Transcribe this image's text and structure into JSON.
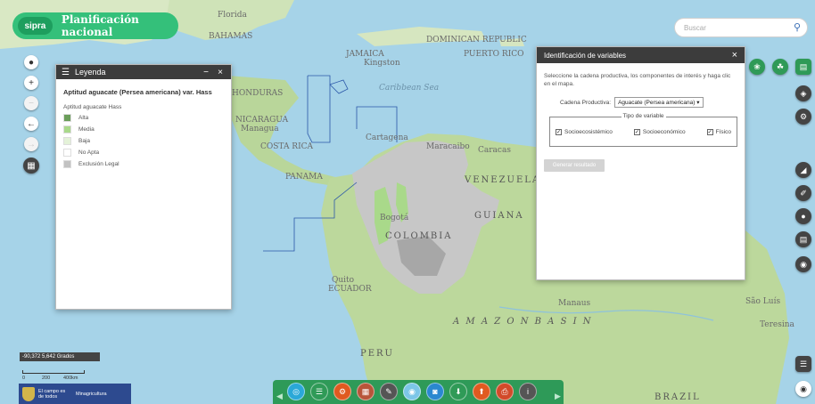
{
  "brand": {
    "logo": "sipra",
    "title": "Planificación nacional"
  },
  "search": {
    "placeholder": "Buscar",
    "icon": "search-icon"
  },
  "map": {
    "labels": {
      "florida": "Florida",
      "bahamas": "BAHAMAS",
      "jamaica": "JAMAICA",
      "kingston": "Kingston",
      "dominican": "DOMINICAN REPUBLIC",
      "puerto_rico": "PUERTO RICO",
      "honduras": "HONDURAS",
      "nicaragua": "NICARAGUA",
      "managua": "Managua",
      "costa_rica": "COSTA RICA",
      "panama": "PANAMA",
      "caribbean": "Caribbean Sea",
      "cartagena": "Cartagena",
      "maracaibo": "Maracaibo",
      "caracas": "Caracas",
      "venezuela": "VENEZUELA",
      "guiana": "GUIANA",
      "colombia": "COLOMBIA",
      "bogota": "Bogotá",
      "ecuador": "ECUADOR",
      "quito": "Quito",
      "amazon": "A M A Z O N     B A S I N",
      "manaus": "Manaus",
      "peru": "PERU",
      "brazil": "BRAZIL",
      "sao_luis": "São Luís",
      "teresina": "Teresina"
    }
  },
  "left_tools": {
    "locate": "locate-icon",
    "zoom_in": "+",
    "zoom_out": "−",
    "back": "←",
    "forward": "→",
    "grid": "grid-icon"
  },
  "legend": {
    "title": "Leyenda",
    "minimize": "−",
    "close": "×",
    "layer_title": "Aptitud aguacate (Persea americana) var. Hass",
    "subtitle": "Aptitud aguacate Hass",
    "items": [
      {
        "label": "Alta",
        "color": "#6b9e5a"
      },
      {
        "label": "Media",
        "color": "#a9d98a"
      },
      {
        "label": "Baja",
        "color": "#e4f2d8"
      },
      {
        "label": "No Apta",
        "color": "#ffffff"
      },
      {
        "label": "Exclusión Legal",
        "color": "#c2c2c2"
      }
    ]
  },
  "vars_panel": {
    "title": "Identificación de variables",
    "close": "×",
    "description": "Seleccione la cadena productiva, los componentes de interés y haga clic en el mapa.",
    "chain_label": "Cadena Productiva:",
    "chain_value": "Aguacate (Persea americana) ▾",
    "fieldset_legend": "Tipo de variable",
    "checks": [
      {
        "label": "Socioecosistémico",
        "checked": true
      },
      {
        "label": "Socioeconómico",
        "checked": true
      },
      {
        "label": "Físico",
        "checked": true
      }
    ],
    "generate_button": "Generar resultado"
  },
  "right_tools": {
    "top": [
      "leaf-icon",
      "hand-leaf-icon",
      "chart-icon"
    ],
    "side": [
      "layers-icon",
      "settings-icon",
      "measure-icon",
      "draw-icon",
      "location-icon",
      "document-icon",
      "map-pin-icon",
      "list-icon",
      "eye-icon"
    ]
  },
  "scale": {
    "coords": "-90,372 5,642 Grados",
    "tick0": "0",
    "tick1": "200",
    "tick2": "400km"
  },
  "logos": {
    "text1": "El campo es de todos",
    "text2": "Minagricultura"
  },
  "toolbar": {
    "buttons": [
      {
        "name": "compass-button",
        "glyph": "◎",
        "color": "#2aa8d8"
      },
      {
        "name": "layers-list-button",
        "glyph": "☰",
        "color": "#2f9a57"
      },
      {
        "name": "chain-button",
        "glyph": "⚙",
        "color": "#e05a20"
      },
      {
        "name": "grid-button",
        "glyph": "▦",
        "color": "#b8553a"
      },
      {
        "name": "pencil-button",
        "glyph": "✎",
        "color": "#555555"
      },
      {
        "name": "globe-button",
        "glyph": "◉",
        "color": "#7cc6e8"
      },
      {
        "name": "camera-button",
        "glyph": "◙",
        "color": "#2a88d0"
      },
      {
        "name": "download-button",
        "glyph": "⬇",
        "color": "#2f9a57"
      },
      {
        "name": "upload-button",
        "glyph": "⬆",
        "color": "#e05a20"
      },
      {
        "name": "print-button",
        "glyph": "⎙",
        "color": "#d24a2a"
      },
      {
        "name": "info-button",
        "glyph": "i",
        "color": "#555555"
      }
    ]
  }
}
